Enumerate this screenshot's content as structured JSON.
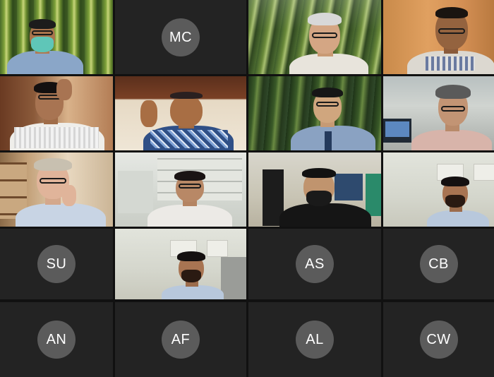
{
  "meeting": {
    "participants": [
      {
        "initials": ""
      },
      {
        "initials": "MC"
      },
      {
        "initials": ""
      },
      {
        "initials": ""
      },
      {
        "initials": ""
      },
      {
        "initials": ""
      },
      {
        "initials": ""
      },
      {
        "initials": ""
      },
      {
        "initials": ""
      },
      {
        "initials": ""
      },
      {
        "initials": ""
      },
      {
        "initials": ""
      },
      {
        "initials": "SU"
      },
      {
        "initials": ""
      },
      {
        "initials": "AS"
      },
      {
        "initials": "CB"
      },
      {
        "initials": "AN"
      },
      {
        "initials": "AF"
      },
      {
        "initials": "AL"
      },
      {
        "initials": "CW"
      }
    ]
  },
  "colors": {
    "avatar_background": "#5b5b5b",
    "tile_background": "#232323",
    "grid_gap": "#111111"
  }
}
